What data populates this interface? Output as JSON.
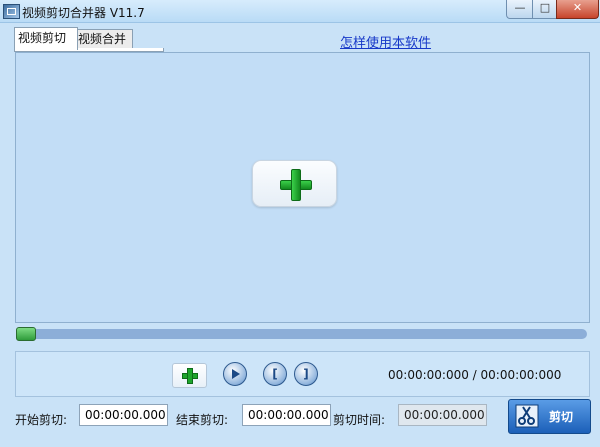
{
  "window": {
    "title": "视频剪切合并器 V11.7",
    "minimize_glyph": "—",
    "maximize_glyph": "□",
    "close_glyph": "✕"
  },
  "tabs": [
    {
      "label": "视频剪切",
      "active": true
    },
    {
      "label": "视频合并",
      "active": false
    }
  ],
  "help_link": "怎样使用本软件",
  "icons": {
    "add_video": "plus-icon",
    "add_small": "plus-icon",
    "play": "play-icon",
    "mark_start": "bracket-left-icon",
    "mark_end": "bracket-right-icon",
    "cut": "scissors-icon"
  },
  "controls": {
    "mark_start_glyph": "[",
    "mark_end_glyph": "]",
    "time_readout": "00:00:00:000 / 00:00:00:000"
  },
  "progress": {
    "value": 0
  },
  "bottom": {
    "start_label": "开始剪切:",
    "start_value": "00:00:00.000",
    "end_label": "结束剪切:",
    "end_value": "00:00:00.000",
    "duration_label": "剪切时间:",
    "duration_value": "00:00:00.000",
    "cut_button_label": "剪切"
  },
  "colors": {
    "background": "#c9e2f7",
    "plus_green": "#1da52c",
    "cut_button": "#1b5fb8",
    "link": "#1638c8"
  }
}
